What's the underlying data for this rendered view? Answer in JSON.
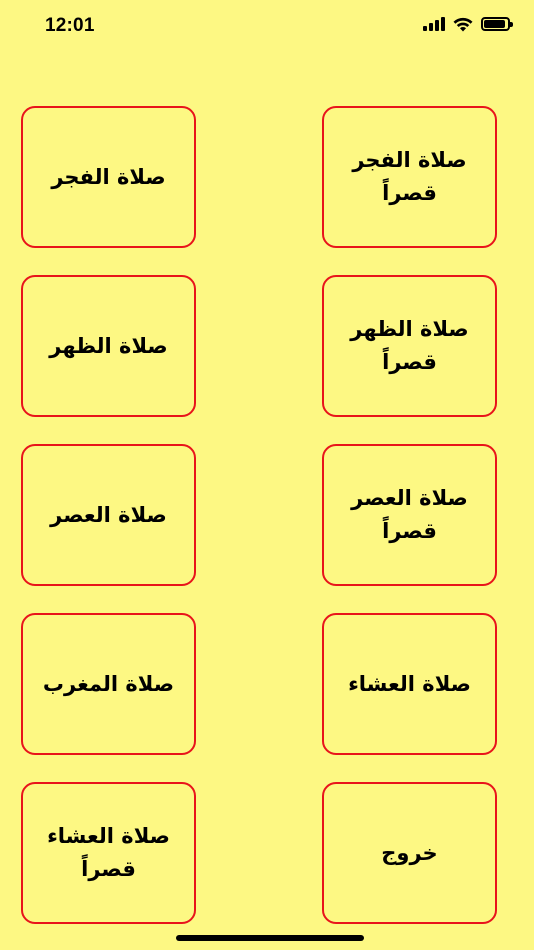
{
  "status_bar": {
    "time": "12:01"
  },
  "buttons": {
    "fajr_qasr": "صلاة الفجر\nقصراً",
    "fajr": "صلاة الفجر",
    "dhuhr_qasr": "صلاة الظهر\nقصراً",
    "dhuhr": "صلاة الظهر",
    "asr_qasr": "صلاة العصر\nقصراً",
    "asr": "صلاة العصر",
    "isha": "صلاة العشاء",
    "maghrib": "صلاة المغرب",
    "exit": "خروج",
    "isha_qasr": "صلاة العشاء\nقصراً"
  },
  "colors": {
    "background": "#FDF883",
    "tile_border": "#E8141B",
    "text": "#000000"
  }
}
